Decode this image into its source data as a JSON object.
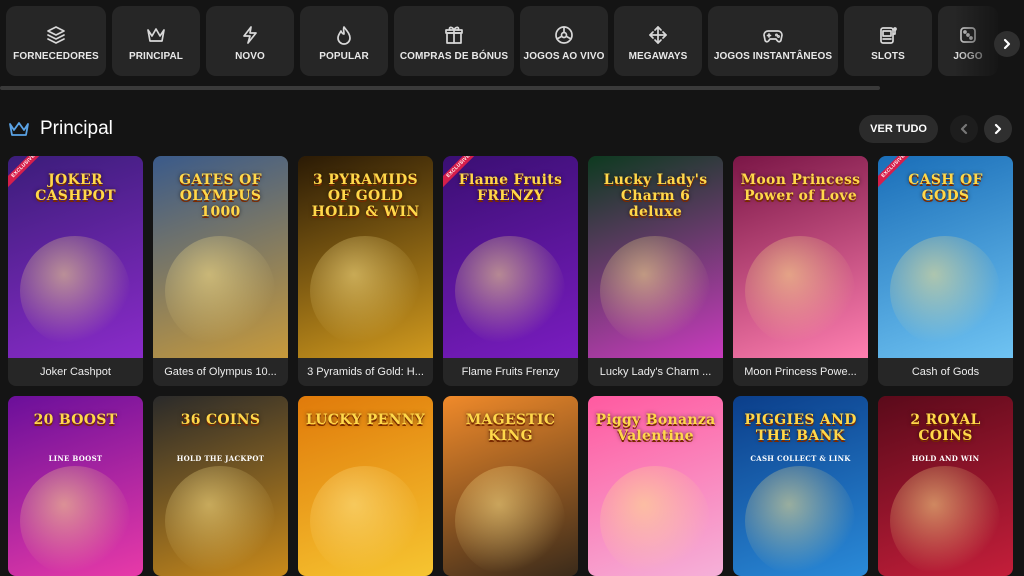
{
  "categories": [
    {
      "label": "FORNECEDORES",
      "icon": "layers-icon"
    },
    {
      "label": "PRINCIPAL",
      "icon": "crown-icon"
    },
    {
      "label": "NOVO",
      "icon": "lightning-icon"
    },
    {
      "label": "POPULAR",
      "icon": "flame-icon"
    },
    {
      "label": "COMPRAS DE BÓNUS",
      "icon": "gift-icon"
    },
    {
      "label": "JOGOS AO VIVO",
      "icon": "roulette-icon"
    },
    {
      "label": "MEGAWAYS",
      "icon": "arrows-cross-icon"
    },
    {
      "label": "JOGOS INSTANTÂNEOS",
      "icon": "gamepad-icon"
    },
    {
      "label": "SLOTS",
      "icon": "slot-machine-icon"
    },
    {
      "label": "JOGO",
      "icon": "dice-icon"
    }
  ],
  "section": {
    "title": "Principal",
    "see_all": "VER TUDO"
  },
  "badge_text": "EXCLUSIVE",
  "row1": [
    {
      "name": "Joker Cashpot",
      "art_text": "JOKER CASHPOT",
      "exclusive": true,
      "colors": [
        "#3b1d7a",
        "#8a2bc9"
      ]
    },
    {
      "name": "Gates of Olympus 10...",
      "art_text": "GATES OF OLYMPUS 1000",
      "exclusive": false,
      "colors": [
        "#3a5a8a",
        "#c79a3b"
      ]
    },
    {
      "name": "3 Pyramids of Gold: H...",
      "art_text": "3 PYRAMIDS OF GOLD HOLD & WIN",
      "exclusive": false,
      "colors": [
        "#2a1a05",
        "#d19a1e"
      ]
    },
    {
      "name": "Flame Fruits Frenzy",
      "art_text": "Flame Fruits FRENZY",
      "exclusive": true,
      "colors": [
        "#3a0f73",
        "#7a1cc0"
      ]
    },
    {
      "name": "Lucky Lady's Charm ...",
      "art_text": "Lucky Lady's Charm 6 deluxe",
      "exclusive": false,
      "colors": [
        "#0d3a1f",
        "#c83bbd"
      ]
    },
    {
      "name": "Moon Princess Powe...",
      "art_text": "Moon Princess Power of Love",
      "exclusive": false,
      "colors": [
        "#7a1646",
        "#ff7fb0"
      ]
    },
    {
      "name": "Cash of Gods",
      "art_text": "CASH OF GODS",
      "exclusive": true,
      "colors": [
        "#1a6eb8",
        "#6fc3f2"
      ]
    }
  ],
  "row2": [
    {
      "art_text": "20 BOOST",
      "sub_text": "LINE BOOST",
      "colors": [
        "#6a0f9a",
        "#e83aa8"
      ]
    },
    {
      "art_text": "36 COINS",
      "sub_text": "HOLD THE JACKPOT",
      "colors": [
        "#2a2a2a",
        "#c98a1a"
      ]
    },
    {
      "art_text": "LUCKY PENNY",
      "sub_text": "",
      "colors": [
        "#e07a0a",
        "#f6c531"
      ]
    },
    {
      "art_text": "MAGESTIC KING",
      "sub_text": "",
      "colors": [
        "#f08a2a",
        "#3a2a1a"
      ]
    },
    {
      "art_text": "Piggy Bonanza Valentine",
      "sub_text": "",
      "colors": [
        "#ff5aa0",
        "#f5b0d8"
      ]
    },
    {
      "art_text": "PIGGIES AND THE BANK",
      "sub_text": "CASH COLLECT & LINK",
      "colors": [
        "#0b3e8a",
        "#2a8ad8"
      ]
    },
    {
      "art_text": "2 ROYAL COINS",
      "sub_text": "HOLD AND WIN",
      "colors": [
        "#5a0a1a",
        "#c41e3a"
      ]
    }
  ]
}
